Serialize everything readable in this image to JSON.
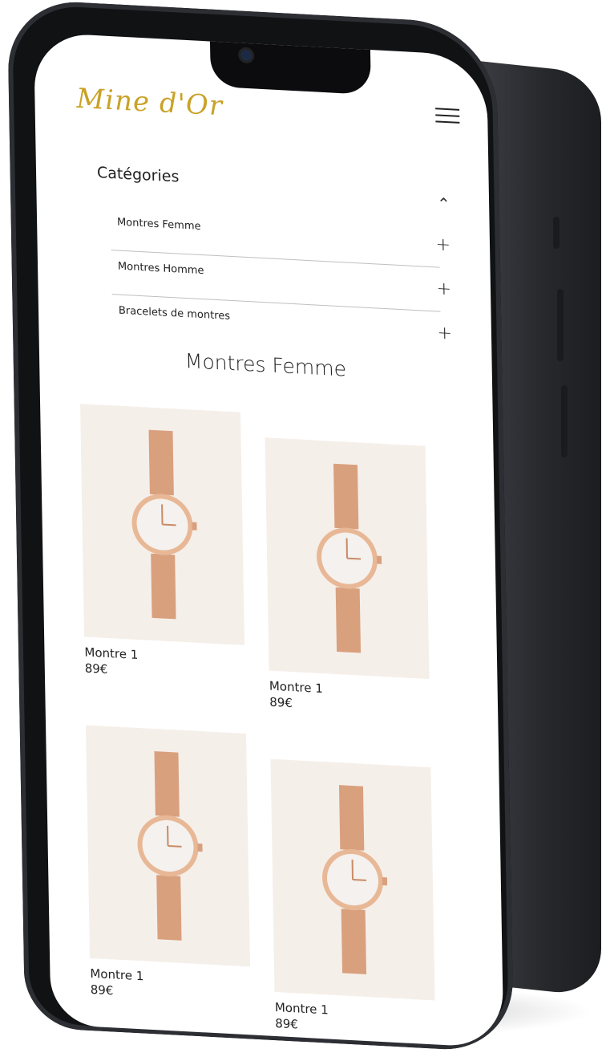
{
  "brand": {
    "logo_text": "Mine d'Or",
    "accent_color": "#c9a227"
  },
  "header": {
    "menu_icon": "hamburger-menu-icon"
  },
  "categories": {
    "title": "Catégories",
    "expanded": true,
    "items": [
      {
        "label": "Montres Femme"
      },
      {
        "label": "Montres Homme"
      },
      {
        "label": "Bracelets de montres"
      }
    ]
  },
  "section": {
    "title": "Montres Femme"
  },
  "products": [
    {
      "name": "Montre 1",
      "price": "89€"
    },
    {
      "name": "Montre 1",
      "price": "89€"
    },
    {
      "name": "Montre 1",
      "price": "89€"
    },
    {
      "name": "Montre 1",
      "price": "89€"
    }
  ]
}
